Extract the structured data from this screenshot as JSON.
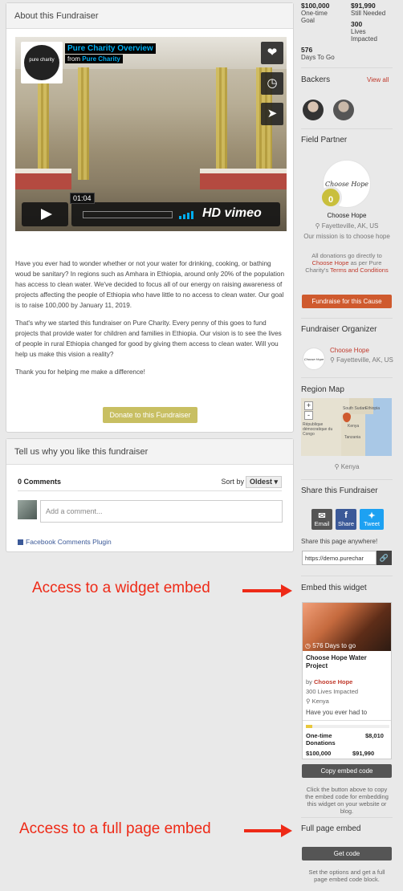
{
  "about": {
    "header": "About this Fundraiser",
    "video": {
      "title": "Pure Charity Overview",
      "from_prefix": "from",
      "from_name": "Pure Charity",
      "logo_text": "pure charity",
      "time": "01:04",
      "brand": "HD vimeo"
    },
    "paragraphs": [
      "Have you ever had to wonder whether or not your water for drinking, cooking, or bathing woud be sanitary? In regions such as Amhara in Ethiopia, around only 20% of the population has access to clean water. We've decided to focus all of our energy on raising awareness of projects affecting the people of Ethiopia who have little to no access to clean water.  Our goal is to raise 100,000 by January 11, 2019.",
      "That's why we started this fundraiser on Pure Charity. Every penny of this goes to fund projects that provide water for children and families in Ethiopia. Our vision is to see the lives of people in rural Ethiopia changed for good by giving them access to clean water. Will you help us make this vision a reality?",
      "Thank you for helping me make a difference!"
    ],
    "donate_label": "Donate to this Fundraiser"
  },
  "comments": {
    "header": "Tell us why you like this fundraiser",
    "count": "0 Comments",
    "sort_label": "Sort by",
    "sort_value": "Oldest",
    "placeholder": "Add a comment...",
    "plugin": "Facebook Comments Plugin"
  },
  "stats": {
    "goal_value": "$100,000",
    "goal_label_1": "One-time",
    "goal_label_2": "Goal",
    "needed_value": "$91,990",
    "needed_label": "Still Needed",
    "lives_value": "300",
    "lives_label_1": "Lives",
    "lives_label_2": "Impacted",
    "days_value": "576",
    "days_label": "Days To Go"
  },
  "backers": {
    "title": "Backers",
    "view_all": "View all"
  },
  "field_partner": {
    "title": "Field Partner",
    "logo_text": "Choose Hope",
    "badge": "0",
    "name": "Choose Hope",
    "location": "Fayetteville, AK, US",
    "mission": "Our mission is to choose hope",
    "donation_note_1": "All donations go directly to",
    "donation_link": "Choose Hope",
    "donation_note_2": "as per Pure Charity's",
    "terms": "Terms and Conditions",
    "button": "Fundraise for this Cause"
  },
  "organizer": {
    "title": "Fundraiser Organizer",
    "logo_text": "Choose Hope",
    "name": "Choose Hope",
    "location": "Fayetteville, AK, US"
  },
  "region_map": {
    "title": "Region Map",
    "zoom_in": "+",
    "zoom_out": "-",
    "labels": [
      "South Sudan",
      "Ethiopia",
      "Kenya",
      "Tanzania",
      "République démocratique du Congo"
    ],
    "location": "Kenya"
  },
  "share": {
    "title": "Share this Fundraiser",
    "email": "Email",
    "facebook": "Share",
    "twitter": "Tweet",
    "note": "Share this page anywhere!",
    "url": "https://demo.purechar"
  },
  "widget": {
    "title": "Embed this widget",
    "days": "576 Days to go",
    "project": "Choose Hope Water Project",
    "by_prefix": "by",
    "by_name": "Choose Hope",
    "lives": "300 Lives Impacted",
    "location": "Kenya",
    "desc": "Have you ever had to",
    "progress": 0.08,
    "donations_label_1": "One-time",
    "donations_label_2": "Donations",
    "donations_value": "$8,010",
    "goal_value": "$100,000",
    "needed_value": "$91,990",
    "copy_button": "Copy embed code",
    "note": "Click the button above to copy the embed code for embedding this widget on your website or blog."
  },
  "full_page": {
    "title": "Full page embed",
    "button": "Get code",
    "note": "Set the options and get a full page embed code block."
  },
  "annotations": {
    "widget": "Access to a widget embed",
    "full_page": "Access to a full page embed",
    "color": "#ee2a17"
  }
}
